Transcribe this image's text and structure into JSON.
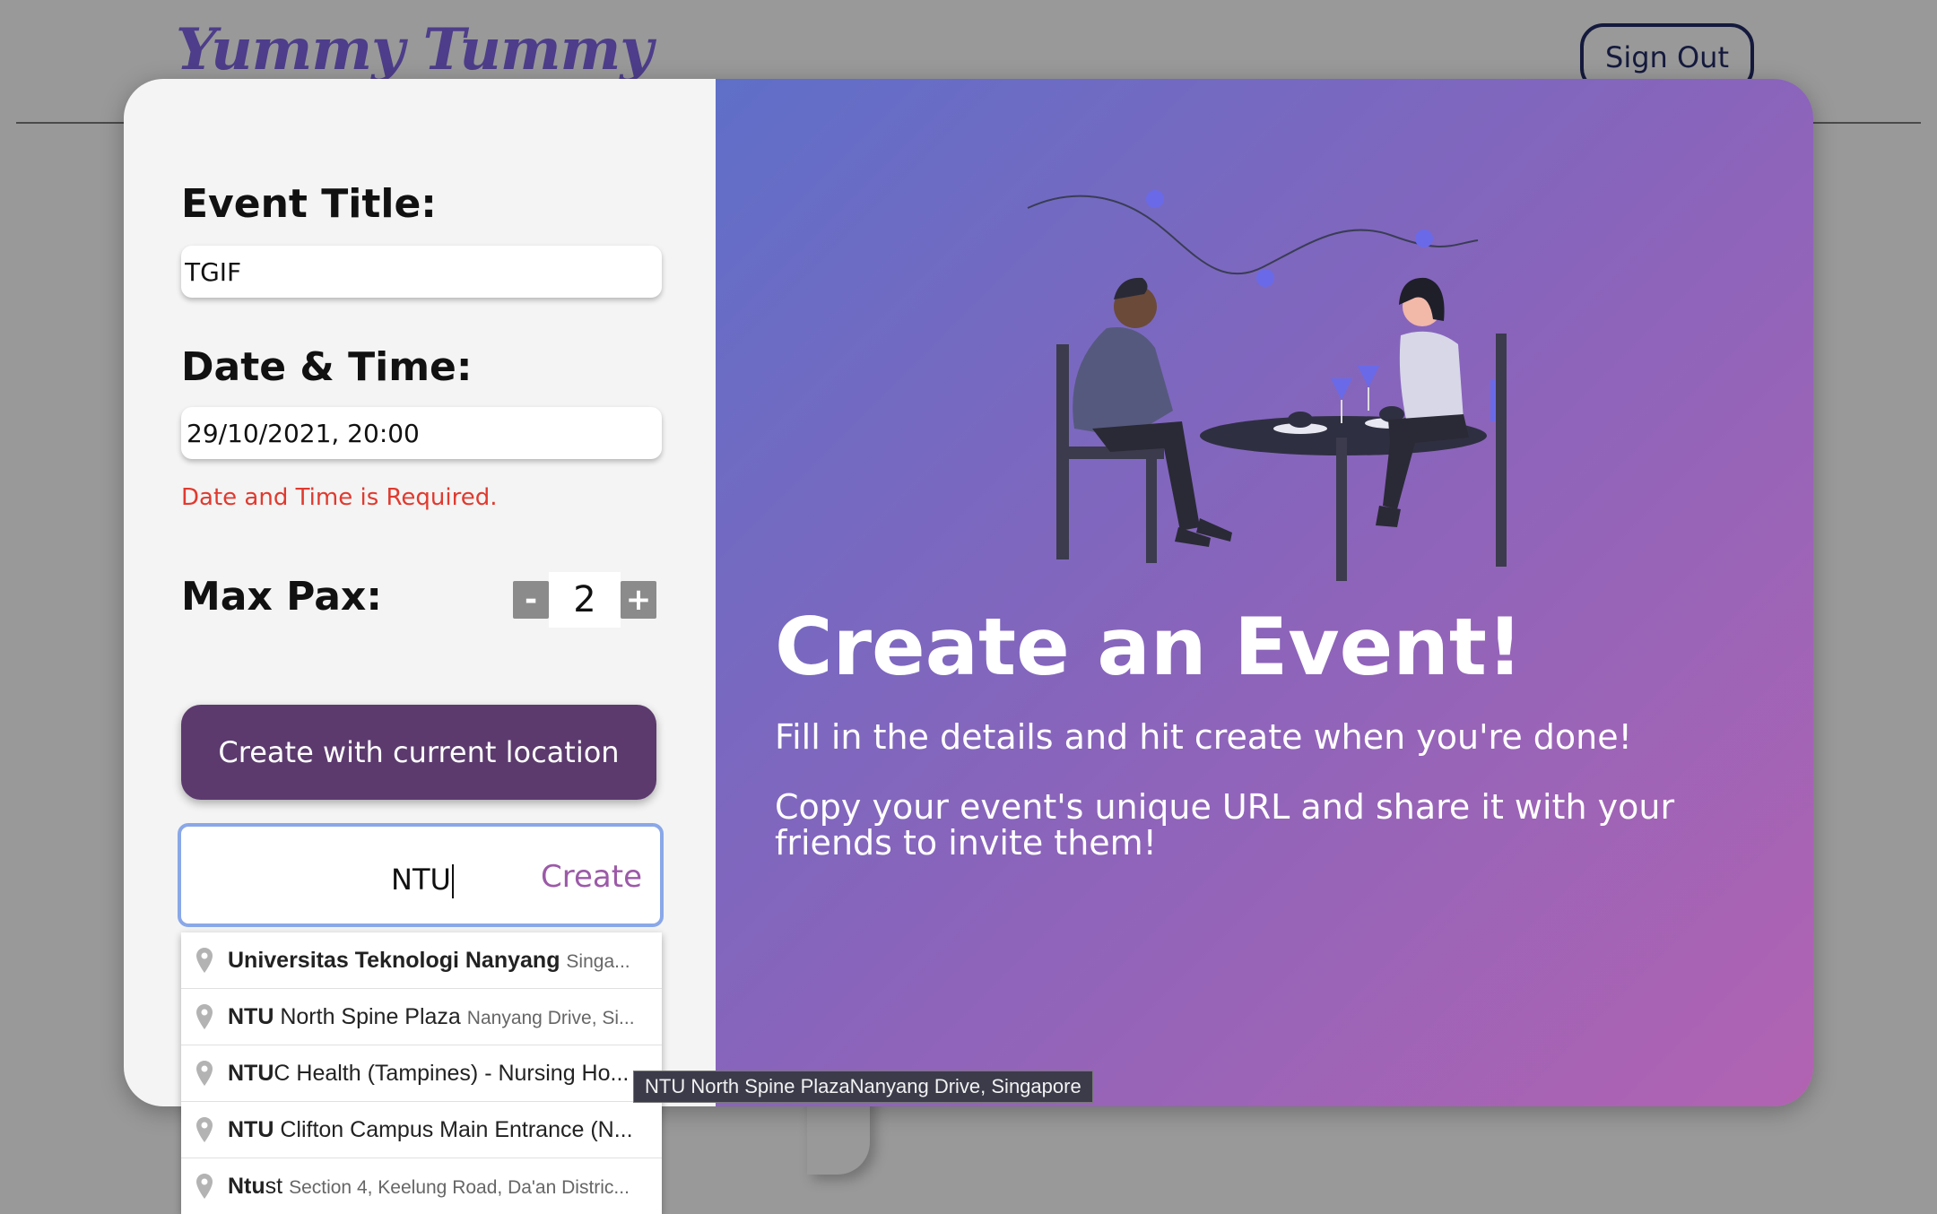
{
  "header": {
    "brand": "Yummy Tummy",
    "sign_out": "Sign Out"
  },
  "form": {
    "title_label": "Event Title:",
    "title_value": "TGIF",
    "datetime_label": "Date & Time:",
    "datetime_value": "29/10/2021, 20:00",
    "datetime_error": "Date and Time is Required.",
    "max_pax_label": "Max Pax:",
    "max_pax_value": "2",
    "decrement": "-",
    "increment": "+",
    "current_location_button": "Create with current location",
    "search_value": "NTU",
    "search_create": "Create"
  },
  "hero": {
    "title": "Create an Event!",
    "line1": "Fill in the details and hit create when you're done!",
    "line2": "Copy your event's unique URL and share it with your friends to invite them!"
  },
  "suggestions": [
    {
      "match": "Universitas Teknologi Nanyang",
      "rest": "",
      "secondary": "Singa..."
    },
    {
      "match": "NTU",
      "rest": " North Spine Plaza",
      "secondary": "Nanyang Drive, Si..."
    },
    {
      "match": "NTU",
      "rest": "C Health (Tampines) - Nursing Ho...",
      "secondary": ""
    },
    {
      "match": "NTU",
      "rest": " Clifton Campus Main Entrance (N...",
      "secondary": ""
    },
    {
      "match": "Ntu",
      "rest": "st",
      "secondary": "Section 4, Keelung Road, Da'an Distric..."
    }
  ],
  "tooltip": "NTU North Spine PlazaNanyang Drive, Singapore",
  "colors": {
    "button_purple": "#5c3a6e",
    "accent_violet": "#9c5aa8",
    "error_red": "#e03a2f",
    "gradient_start": "#5f6fc8",
    "gradient_end": "#b263b2"
  }
}
